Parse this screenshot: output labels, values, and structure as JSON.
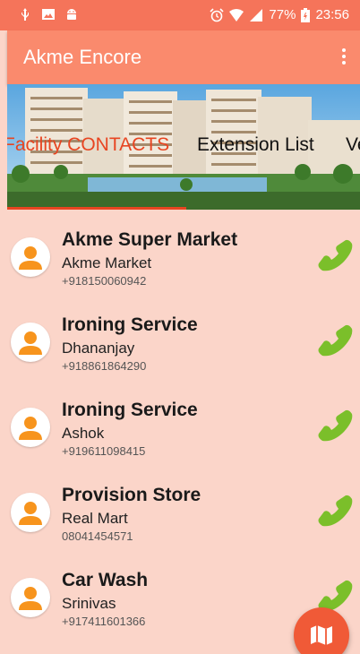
{
  "status_bar": {
    "battery": "77%",
    "time": "23:56",
    "icons": [
      "usb-icon",
      "image-icon",
      "android-icon",
      "alarm-icon",
      "wifi-icon",
      "signal-icon",
      "battery-icon"
    ]
  },
  "app_bar": {
    "title": "Akme Encore",
    "menu_icon": "more-vert-icon"
  },
  "tabs": [
    {
      "label": "Facility CONTACTS",
      "active": true
    },
    {
      "label": "Extension List",
      "active": false
    },
    {
      "label": "Ve",
      "active": false
    }
  ],
  "contacts": [
    {
      "title": "Akme Super Market",
      "name": "Akme Market",
      "phone": "+918150060942"
    },
    {
      "title": "Ironing Service",
      "name": "Dhananjay",
      "phone": "+918861864290"
    },
    {
      "title": "Ironing Service",
      "name": "Ashok",
      "phone": "+919611098415"
    },
    {
      "title": "Provision Store",
      "name": "Real Mart",
      "phone": "08041454571"
    },
    {
      "title": "Car Wash",
      "name": "Srinivas",
      "phone": "+917411601366"
    }
  ],
  "fab": {
    "icon": "map-icon"
  },
  "colors": {
    "status_bar": "#f5745a",
    "app_bar": "#fa8a6d",
    "accent": "#e84521",
    "list_bg": "#fbd5c9",
    "call_green": "#7bbf2a",
    "avatar_orange": "#f7941d"
  }
}
